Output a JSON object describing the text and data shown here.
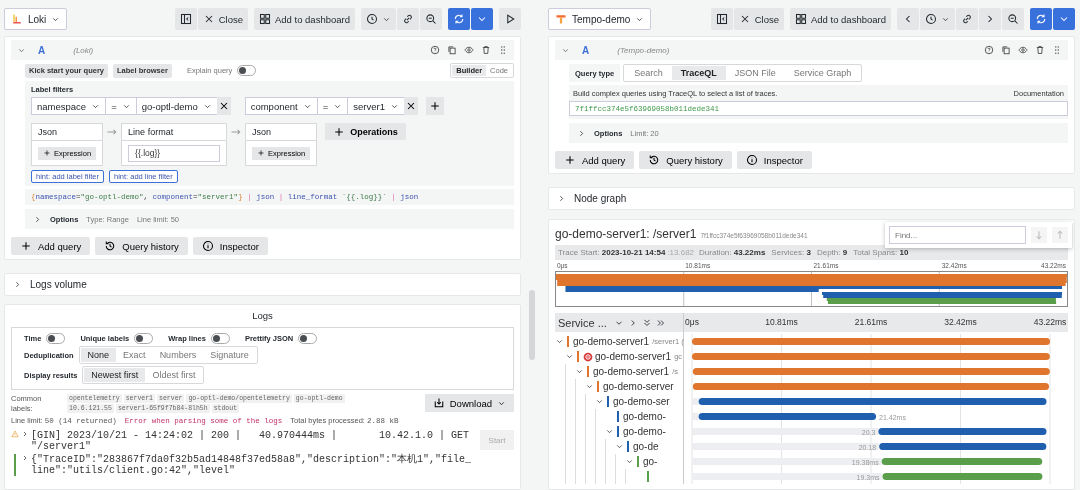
{
  "left_pane": {
    "datasource": "Loki",
    "toolbar": {
      "close": "Close",
      "add_to_dashboard": "Add to dashboard"
    },
    "query": {
      "letter": "A",
      "datasource": "(Loki)",
      "kick_start": "Kick start your query",
      "label_browser": "Label browser",
      "explain": {
        "label": "Explain query",
        "on": false
      },
      "editor_modes": [
        {
          "label": "Builder",
          "selected": true
        },
        {
          "label": "Code",
          "selected": false
        }
      ],
      "label_filters": {
        "title": "Label filters",
        "filters": [
          {
            "label": "namespace",
            "operator": "=",
            "value": "go-optl-demo"
          },
          {
            "label": "component",
            "operator": "=",
            "value": "server1"
          }
        ]
      },
      "operations": [
        {
          "title": "Json",
          "kind": "expression",
          "button": "Expression"
        },
        {
          "title": "Line format",
          "kind": "input",
          "value": "{{.log}}"
        },
        {
          "title": "Json",
          "kind": "expression",
          "button": "Expression"
        }
      ],
      "operations_button": "Operations",
      "hints": [
        "hint: add label filter",
        "hint: add line filter"
      ],
      "code": [
        {
          "text": "{",
          "kind": "brace"
        },
        {
          "text": "namespace",
          "kind": "label"
        },
        {
          "text": "=",
          "kind": "op"
        },
        {
          "text": "\"go-optl-demo\"",
          "kind": "string"
        },
        {
          "text": ", ",
          "kind": "op"
        },
        {
          "text": "component",
          "kind": "label"
        },
        {
          "text": "=",
          "kind": "op"
        },
        {
          "text": "\"server1\"",
          "kind": "string"
        },
        {
          "text": "}",
          "kind": "brace"
        },
        {
          "text": " | ",
          "kind": "pipe"
        },
        {
          "text": "json",
          "kind": "func"
        },
        {
          "text": " | ",
          "kind": "pipe"
        },
        {
          "text": "line_format",
          "kind": "func"
        },
        {
          "text": " `{{.log}}`",
          "kind": "string"
        },
        {
          "text": " | ",
          "kind": "pipe"
        },
        {
          "text": "json",
          "kind": "func"
        }
      ],
      "options": {
        "title": "Options",
        "expanded": false,
        "details": [
          "Type: Range",
          "Line limit: 50"
        ]
      }
    },
    "actions": [
      "Add query",
      "Query history",
      "Inspector"
    ],
    "logs_volume": {
      "title": "Logs volume",
      "expanded": false
    },
    "logs": {
      "title": "Logs",
      "toggles": [
        {
          "label": "Time",
          "on": false
        },
        {
          "label": "Unique labels",
          "on": false
        },
        {
          "label": "Wrap lines",
          "on": false
        },
        {
          "label": "Prettify JSON",
          "on": false
        }
      ],
      "deduplication": {
        "label": "Deduplication",
        "options": [
          {
            "label": "None",
            "selected": true
          },
          {
            "label": "Exact",
            "selected": false
          },
          {
            "label": "Numbers",
            "selected": false
          },
          {
            "label": "Signature",
            "selected": false
          }
        ]
      },
      "display_results": {
        "label": "Display results",
        "options": [
          {
            "label": "Newest first",
            "selected": true
          },
          {
            "label": "Oldest first",
            "selected": false
          }
        ]
      },
      "common_labels": {
        "label": "Common labels:",
        "values": [
          "opentelemetry",
          "server1",
          "server",
          "go-optl-demo/opentelemetry",
          "go-optl-demo",
          "10.6.121.55",
          "server1-65f9f7b84-8lh5h",
          "stdout"
        ]
      },
      "download": "Download",
      "meta": [
        {
          "kind": "stat",
          "label": "Line limit:",
          "value": "50 (14 returned)"
        },
        {
          "kind": "error",
          "text": "Error when parsing some of the logs"
        },
        {
          "kind": "stat",
          "label": "Total bytes processed:",
          "value": "2.88 kB"
        }
      ],
      "rows": [
        {
          "kind": "warning",
          "text": "[GIN] 2023/10/21 - 14:24:02 | 200 |   40.970444ms |       10.42.1.0 | GET      \"/server1\""
        },
        {
          "kind": "info",
          "text": "{\"TraceID\":\"283867f7da0f32b5ad14848f37ed58a8\",\"description\":\"本机1\",\"file_line\":\"utils/client.go:42\",\"level\""
        }
      ],
      "start_button": "Start"
    }
  },
  "right_pane": {
    "datasource": "Tempo-demo",
    "toolbar": {
      "close": "Close",
      "add_to_dashboard": "Add to dashboard"
    },
    "query": {
      "letter": "A",
      "datasource": "(Tempo-demo)",
      "query_type": {
        "label": "Query type",
        "options": [
          {
            "label": "Search",
            "selected": false
          },
          {
            "label": "TraceQL",
            "selected": true
          },
          {
            "label": "JSON File",
            "selected": false
          },
          {
            "label": "Service Graph",
            "selected": false
          }
        ]
      },
      "help": "Build complex queries using TraceQL to select a list of traces.",
      "documentation": "Documentation",
      "value": "7f1ffcc374e5f63969058b011dede341",
      "options": {
        "title": "Options",
        "expanded": false,
        "details": [
          "Limit: 20"
        ]
      }
    },
    "actions": [
      "Add query",
      "Query history",
      "Inspector"
    ],
    "node_graph": {
      "title": "Node graph",
      "expanded": false
    },
    "trace": {
      "title": "go-demo-server1: /server1",
      "trace_id": "7f1ffcc374e5f63969058b011dede341",
      "find": {
        "placeholder": "Find..."
      },
      "stats": [
        {
          "label": "Trace Start:",
          "value": "2023-10-21 14:54",
          "suffix": ":13.682"
        },
        {
          "label": "Duration:",
          "value": "43.22ms"
        },
        {
          "label": "Services:",
          "value": "3"
        },
        {
          "label": "Depth:",
          "value": "9"
        },
        {
          "label": "Total Spans:",
          "value": "10"
        }
      ],
      "minimap_ticks": [
        "0μs",
        "10.81ms",
        "21.61ms",
        "32.42ms",
        "43.22ms"
      ],
      "header_title": "Service ...",
      "spans": [
        {
          "service": "go-demo-server1",
          "operation": "/server1 (",
          "color": "#e0752d",
          "error": false,
          "expanded": true,
          "children": [
            {
              "service": "go-demo-server1",
              "operation": "gc",
              "color": "#e0752d",
              "error": true,
              "expanded": true,
              "children": [
                {
                  "service": "go-demo-server1",
                  "operation": "/s",
                  "color": "#e0752d",
                  "error": false,
                  "expanded": true,
                  "children": [
                    {
                      "service": "go-demo-server",
                      "color": "#e0752d",
                      "error": false,
                      "expanded": true,
                      "children": [
                        {
                          "service": "go-demo-ser",
                          "color": "#1f5fae",
                          "error": false,
                          "expanded": true,
                          "children": [
                            {
                              "service": "go-demo-",
                              "color": "#1f5fae",
                              "error": false,
                              "duration_label": "21.42ms"
                            },
                            {
                              "service": "go-demo-",
                              "color": "#1f5fae",
                              "error": false,
                              "duration_label": "20.3",
                              "expanded": true,
                              "children": [
                                {
                                  "service": "go-de",
                                  "color": "#1f5fae",
                                  "error": false,
                                  "duration_label": "20.18",
                                  "expanded": true,
                                  "children": [
                                    {
                                      "service": "go-",
                                      "color": "#5a9e4b",
                                      "error": false,
                                      "duration_label": "19.38ms",
                                      "expanded": true,
                                      "children": [
                                        {
                                          "color": "#5a9e4b",
                                          "error": false,
                                          "duration_label": "19.3ms"
                                        }
                                      ]
                                    }
                                  ]
                                }
                              ]
                            }
                          ]
                        }
                      ]
                    }
                  ]
                }
              ]
            }
          ]
        }
      ],
      "chart_data": {
        "type": "bar",
        "orientation": "horizontal",
        "stacked": true,
        "grid": true,
        "xlim": [
          0,
          43.22
        ],
        "xticks": [
          {
            "value": 0,
            "label": "0μs"
          },
          {
            "value": 10.81,
            "label": "10.81ms"
          },
          {
            "value": 21.61,
            "label": "21.61ms"
          },
          {
            "value": 32.42,
            "label": "32.42ms"
          },
          {
            "value": 43.22,
            "label": "43.22ms"
          }
        ],
        "series": [
          {
            "color": "#eceef1",
            "values": [
              0,
              0,
              0.1,
              0.1,
              0.8,
              0.8,
              22.5,
              22.6,
              22.9,
              23.0
            ]
          },
          {
            "colors": [
              "#e0752d",
              "#e0752d",
              "#e0752d",
              "#e0752d",
              "#1f5fae",
              "#1f5fae",
              "#1f5fae",
              "#1f5fae",
              "#5a9e4b",
              "#5a9e4b"
            ],
            "values": [
              43.22,
              43.2,
              43.1,
              43.0,
              42.0,
              21.42,
              20.3,
              20.18,
              19.38,
              19.3
            ]
          }
        ]
      }
    }
  }
}
